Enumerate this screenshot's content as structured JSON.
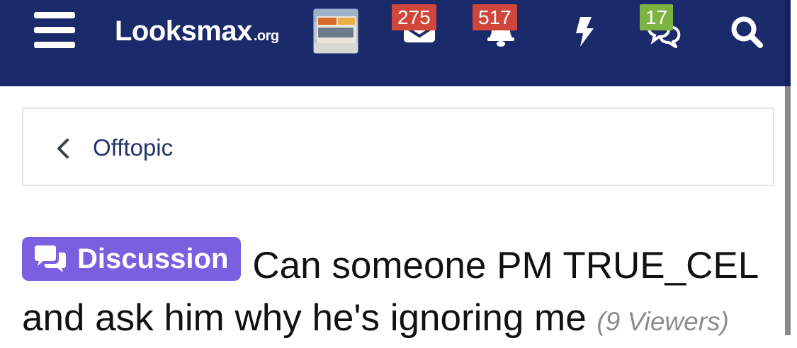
{
  "header": {
    "logo_text": "Looksmax",
    "logo_tld": ".org",
    "conversations_badge": "275",
    "alerts_badge": "517",
    "whats_new_badge": "17"
  },
  "breadcrumb": {
    "label": "Offtopic"
  },
  "thread": {
    "prefix": "Discussion",
    "title": "Can someone PM TRUE_CEL and ask him why he's ignoring me",
    "viewers": "(9 Viewers)"
  },
  "colors": {
    "header_bg": "#1b2a6b",
    "badge_red": "#d0463b",
    "badge_green": "#7cb342",
    "prefix_purple": "#7a5fe0",
    "link_blue": "#24336b"
  },
  "icons": [
    "menu-icon",
    "envelope-icon",
    "bell-icon",
    "bolt-icon",
    "chat-bubbles-icon",
    "search-icon",
    "chevron-left-icon",
    "discussion-icon"
  ]
}
